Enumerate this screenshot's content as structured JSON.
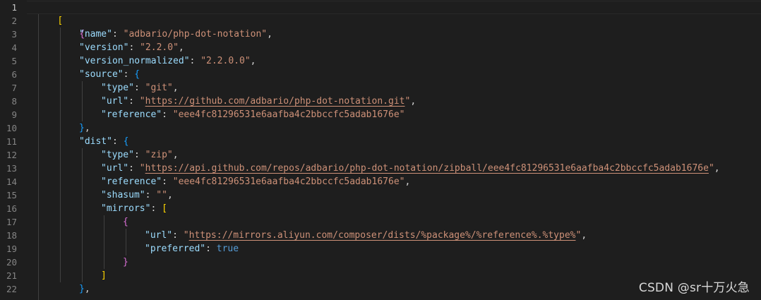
{
  "line_numbers": [
    "1",
    "2",
    "3",
    "4",
    "5",
    "6",
    "7",
    "8",
    "9",
    "10",
    "11",
    "12",
    "13",
    "14",
    "15",
    "16",
    "17",
    "18",
    "19",
    "20",
    "21",
    "22"
  ],
  "code": {
    "l1_open": "[",
    "l2_open": "{",
    "name_key": "\"name\"",
    "name_val": "\"adbario/php-dot-notation\"",
    "version_key": "\"version\"",
    "version_val": "\"2.2.0\"",
    "version_norm_key": "\"version_normalized\"",
    "version_norm_val": "\"2.2.0.0\"",
    "source_key": "\"source\"",
    "source_open": "{",
    "source_type_key": "\"type\"",
    "source_type_val": "\"git\"",
    "source_url_key": "\"url\"",
    "source_url_q1": "\"",
    "source_url_val": "https://github.com/adbario/php-dot-notation.git",
    "source_url_q2": "\"",
    "source_ref_key": "\"reference\"",
    "source_ref_val": "\"eee4fc81296531e6aafba4c2bbccfc5adab1676e\"",
    "source_close": "}",
    "dist_key": "\"dist\"",
    "dist_open": "{",
    "dist_type_key": "\"type\"",
    "dist_type_val": "\"zip\"",
    "dist_url_key": "\"url\"",
    "dist_url_q1": "\"",
    "dist_url_val": "https://api.github.com/repos/adbario/php-dot-notation/zipball/eee4fc81296531e6aafba4c2bbccfc5adab1676e",
    "dist_url_q2": "\"",
    "dist_ref_key": "\"reference\"",
    "dist_ref_val": "\"eee4fc81296531e6aafba4c2bbccfc5adab1676e\"",
    "shasum_key": "\"shasum\"",
    "shasum_val": "\"\"",
    "mirrors_key": "\"mirrors\"",
    "mirrors_open": "[",
    "mirror_open": "{",
    "mirror_url_key": "\"url\"",
    "mirror_url_q1": "\"",
    "mirror_url_val": "https://mirrors.aliyun.com/composer/dists/%package%/%reference%.%type%",
    "mirror_url_q2": "\"",
    "preferred_key": "\"preferred\"",
    "preferred_val": "true",
    "mirror_close": "}",
    "mirrors_close": "]",
    "dist_close": "}"
  },
  "watermark": "CSDN @sr十万火急"
}
